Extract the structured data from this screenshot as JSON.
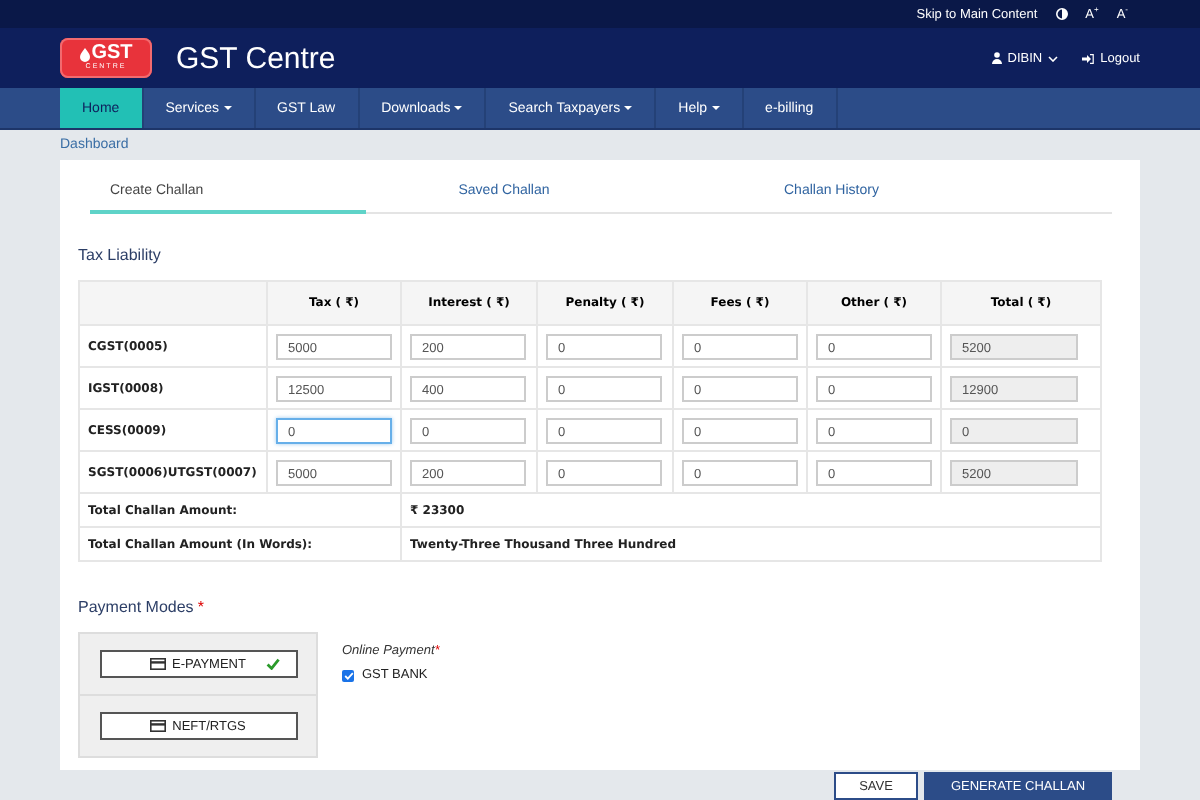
{
  "top_bar": {
    "skip_link": "Skip to Main Content",
    "font_increase": "A$^{+}$",
    "font_decrease": "A$^{-}$"
  },
  "header": {
    "logo_text": "GST",
    "logo_subtext": "CENTRE",
    "title": "GST Centre",
    "user": "DIBIN",
    "logout": "Logout"
  },
  "nav": [
    {
      "label": "Home",
      "selected": true,
      "dropdown": false
    },
    {
      "label": "Services",
      "selected": false,
      "dropdown": true
    },
    {
      "label": "GST Law",
      "selected": false,
      "dropdown": false
    },
    {
      "label": "Downloads",
      "selected": false,
      "dropdown": true
    },
    {
      "label": "Search Taxpayers",
      "selected": false,
      "dropdown": true
    },
    {
      "label": "Help",
      "selected": false,
      "dropdown": true
    },
    {
      "label": "e-billing",
      "selected": false,
      "dropdown": false
    }
  ],
  "breadcrumb": "Dashboard",
  "tabs": [
    {
      "label": "Create Challan",
      "selected": true
    },
    {
      "label": "Saved Challan",
      "selected": false
    },
    {
      "label": "Challan History",
      "selected": false
    }
  ],
  "tax_liability": {
    "title": "Tax Liability",
    "columns": [
      "Tax ( ₹)",
      "Interest ( ₹)",
      "Penalty ( ₹)",
      "Fees ( ₹)",
      "Other ( ₹)",
      "Total ( ₹)"
    ],
    "rows": [
      {
        "label": "CGST(0005)",
        "values": [
          "5000",
          "200",
          "0",
          "0",
          "0"
        ],
        "total": "5200",
        "tax_focused": false
      },
      {
        "label": "IGST(0008)",
        "values": [
          "12500",
          "400",
          "0",
          "0",
          "0"
        ],
        "total": "12900",
        "tax_focused": false
      },
      {
        "label": "CESS(0009)",
        "values": [
          "0",
          "0",
          "0",
          "0",
          "0"
        ],
        "total": "0",
        "tax_focused": true
      },
      {
        "label": "SGST(0006)UTGST(0007)",
        "values": [
          "5000",
          "200",
          "0",
          "0",
          "0"
        ],
        "total": "5200",
        "tax_focused": false
      }
    ],
    "totals": [
      {
        "label": "Total Challan Amount:",
        "value": "₹ 23300"
      },
      {
        "label": "Total Challan Amount (In Words):",
        "value": "Twenty-Three Thousand Three Hundred"
      }
    ]
  },
  "payment": {
    "title": "Payment Modes",
    "required_mark": "*",
    "modes": [
      {
        "label": "E-PAYMENT",
        "selected": true
      },
      {
        "label": "NEFT/RTGS",
        "selected": false
      }
    ],
    "online_label": "Online Payment",
    "online_required_mark": "*",
    "options": [
      {
        "label": "GST BANK",
        "checked": true
      }
    ]
  },
  "buttons": [
    {
      "label": "SAVE",
      "kind": "secondary"
    },
    {
      "label": "GENERATE CHALLAN",
      "kind": "primary"
    }
  ]
}
